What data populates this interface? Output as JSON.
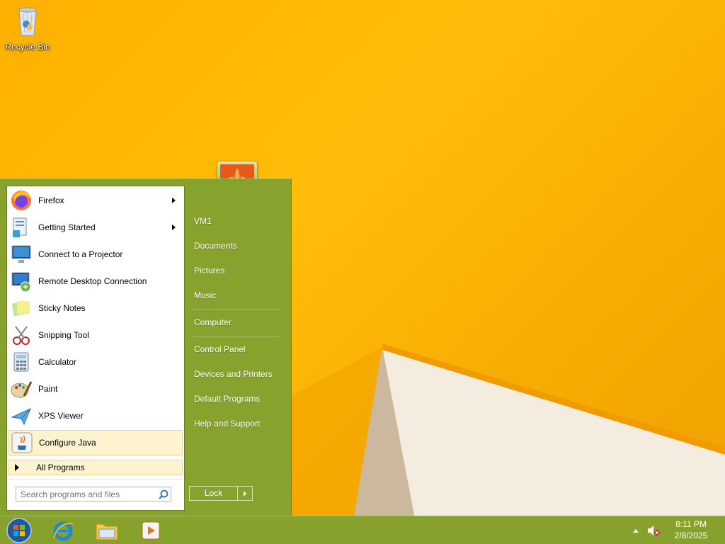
{
  "desktop": {
    "icons": [
      {
        "label": "Recycle Bin",
        "icon": "recycle-bin-icon"
      }
    ]
  },
  "start_menu": {
    "programs": [
      {
        "label": "Firefox",
        "icon": "firefox-icon",
        "has_submenu": true
      },
      {
        "label": "Getting Started",
        "icon": "getting-started-icon",
        "has_submenu": true
      },
      {
        "label": "Connect to a Projector",
        "icon": "projector-icon",
        "has_submenu": false
      },
      {
        "label": "Remote Desktop Connection",
        "icon": "remote-desktop-icon",
        "has_submenu": false
      },
      {
        "label": "Sticky Notes",
        "icon": "sticky-notes-icon",
        "has_submenu": false
      },
      {
        "label": "Snipping Tool",
        "icon": "snipping-tool-icon",
        "has_submenu": false
      },
      {
        "label": "Calculator",
        "icon": "calculator-icon",
        "has_submenu": false
      },
      {
        "label": "Paint",
        "icon": "paint-icon",
        "has_submenu": false
      },
      {
        "label": "XPS Viewer",
        "icon": "xps-viewer-icon",
        "has_submenu": false
      },
      {
        "label": "Configure Java",
        "icon": "java-icon",
        "has_submenu": false,
        "highlighted": true
      }
    ],
    "all_programs_label": "All Programs",
    "search_placeholder": "Search programs and files",
    "right_links": {
      "user": "VM1",
      "documents": "Documents",
      "pictures": "Pictures",
      "music": "Music",
      "computer": "Computer",
      "control_panel": "Control Panel",
      "devices_printers": "Devices and Printers",
      "default_programs": "Default Programs",
      "help_support": "Help and Support"
    },
    "lock_label": "Lock"
  },
  "taskbar": {
    "pinned": [
      "start-orb-icon",
      "internet-explorer-icon",
      "file-explorer-icon",
      "media-player-icon"
    ],
    "tray": {
      "time": "8:11 PM",
      "date": "2/8/2025"
    }
  },
  "colors": {
    "accent": "#88a22e",
    "wallpaper": "#ffb400",
    "highlight": "#fdf3cf"
  }
}
